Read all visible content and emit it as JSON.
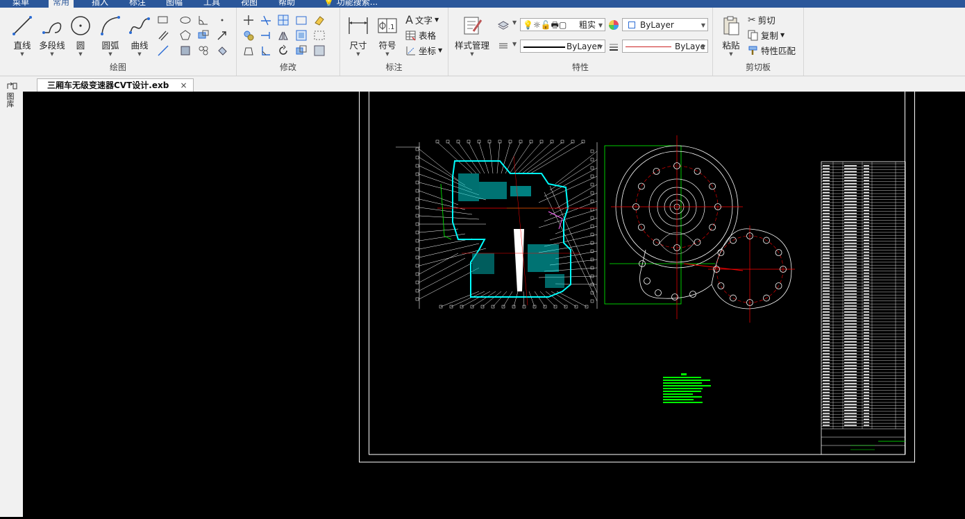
{
  "menubar": {
    "tabs": [
      "菜单",
      "常用",
      "插入",
      "标注",
      "图幅",
      "工具",
      "视图",
      "帮助"
    ],
    "search_placeholder": "功能搜索..."
  },
  "ribbon": {
    "draw": {
      "line": "直线",
      "polyline": "多段线",
      "circle": "圆",
      "arc": "圆弧",
      "curve": "曲线",
      "group_label": "绘图"
    },
    "modify": {
      "group_label": "修改"
    },
    "annotate": {
      "dimension": "尺寸",
      "symbol": "符号",
      "text": "文字",
      "table": "表格",
      "coordinate": "坐标",
      "group_label": "标注"
    },
    "properties": {
      "style_manager": "样式管理",
      "layer_value": "粗实",
      "color_value": "ByLayer",
      "linetype_value": "ByLayer",
      "linewidth_value": "ByLaye",
      "group_label": "特性"
    },
    "clipboard": {
      "paste": "粘贴",
      "cut": "剪切",
      "copy": "复制",
      "match_props": "特性匹配",
      "group_label": "剪切板"
    }
  },
  "left_panel": {
    "label": "图库"
  },
  "document": {
    "tab_title": "三厢车无级变速器CVT设计.exb",
    "close": "×"
  },
  "colors": {
    "ribbon_bg": "#f1f1f1",
    "menubar": "#2b579a",
    "canvas": "#000000",
    "cyan": "#00ffff",
    "green": "#00ff00",
    "red": "#ff0000",
    "white": "#ffffff"
  }
}
